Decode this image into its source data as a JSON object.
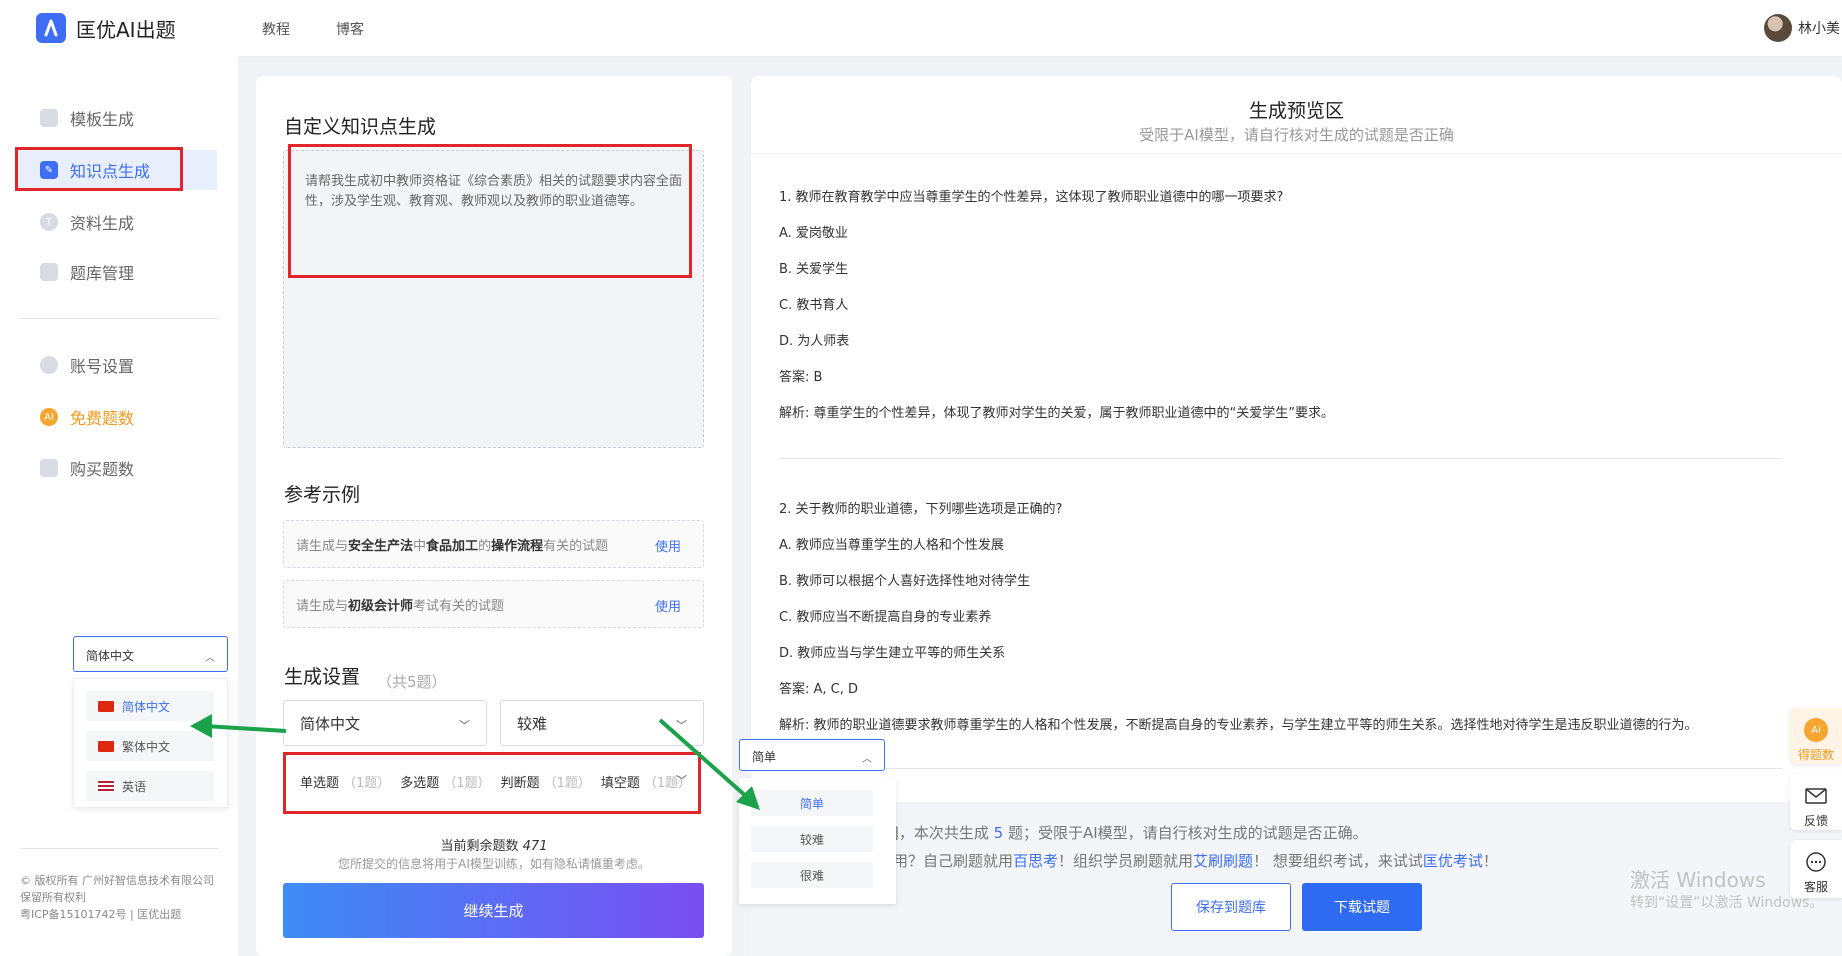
{
  "header": {
    "app_name": "匡优AI出题",
    "nav": [
      "教程",
      "博客"
    ],
    "user_name": "林小美"
  },
  "sidebar": {
    "items": [
      {
        "label": "模板生成",
        "icon": "template-icon"
      },
      {
        "label": "知识点生成",
        "icon": "knowledge-icon"
      },
      {
        "label": "资料生成",
        "icon": "material-icon"
      },
      {
        "label": "题库管理",
        "icon": "question-bank-icon"
      },
      {
        "label": "账号设置",
        "icon": "user-icon"
      },
      {
        "label": "免费题数",
        "icon": "free-quota-icon",
        "badge": "AI"
      },
      {
        "label": "购买题数",
        "icon": "purchase-icon"
      }
    ],
    "footer": [
      "© 版权所有 广州好智信息技术有限公司",
      "保留所有权利",
      "粤ICP备15101742号 | 匡优出题"
    ]
  },
  "language_dropdown": {
    "selected": "简体中文",
    "options": [
      "简体中文",
      "繁体中文",
      "英语"
    ]
  },
  "knowledge": {
    "title": "自定义知识点生成",
    "prompt": "请帮我生成初中教师资格证《综合素质》相关的试题要求内容全面性，涉及学生观、教育观、教师观以及教师的职业道德等。"
  },
  "examples": {
    "title": "参考示例",
    "items": [
      {
        "parts": [
          "请生成与",
          "安全生产法",
          "中",
          "食品加工",
          "的",
          "操作流程",
          "有关的试题"
        ],
        "action": "使用"
      },
      {
        "parts": [
          "请生成与",
          "初级会计师",
          "考试有关的试题"
        ],
        "action": "使用"
      }
    ]
  },
  "settings": {
    "title": "生成设置",
    "count_note": "（共5题）",
    "language": "简体中文",
    "difficulty": "较难",
    "question_types": [
      {
        "label": "单选题",
        "count": "（1题）"
      },
      {
        "label": "多选题",
        "count": "（1题）"
      },
      {
        "label": "判断题",
        "count": "（1题）"
      },
      {
        "label": "填空题",
        "count": "（1题）"
      },
      {
        "label": "问",
        "count": ""
      }
    ],
    "remaining_label": "当前剩余题数",
    "remaining_value": "471",
    "privacy_note": "您所提交的信息将用于AI模型训练，如有隐私请慎重考虑。",
    "generate_button": "继续生成"
  },
  "preview": {
    "title": "生成预览区",
    "subtitle": "受限于AI模型，请自行核对生成的试题是否正确",
    "q1": {
      "question": "1. 教师在教育教学中应当尊重学生的个性差异，这体现了教师职业道德中的哪一项要求?",
      "options": [
        "A. 爱岗敬业",
        "B. 关爱学生",
        "C. 教书育人",
        "D. 为人师表"
      ],
      "answer": "答案: B",
      "analysis": "解析: 尊重学生的个性差异，体现了教师对学生的关爱，属于教师职业道德中的“关爱学生”要求。"
    },
    "q2": {
      "question": "2. 关于教师的职业道德，下列哪些选项是正确的?",
      "options": [
        "A. 教师应当尊重学生的人格和个性发展",
        "B. 教师可以根据个人喜好选择性地对待学生",
        "C. 教师应当不断提高自身的专业素养",
        "D. 教师应当与学生建立平等的师生关系"
      ],
      "answer": "答案: A, C, D",
      "analysis": "解析: 教师的职业道德要求教师尊重学生的人格和个性发展，不断提高自身的专业素养，与学生建立平等的师生关系。选择性地对待学生是违反职业道德的行为。"
    },
    "notice_1_pre": "]，本次共生成",
    "notice_1_num": "5",
    "notice_1_post": "题；受限于AI模型，请自行核对生成的试题是否正确。",
    "notice_2_a": "用？自己刷题就用",
    "notice_2_link1": "百思考",
    "notice_2_b": "！组织学员刷题就用",
    "notice_2_link2": "艾刷刷题",
    "notice_2_c": "！ 想要组织考试，来试试",
    "notice_2_link3": "匡优考试",
    "notice_2_d": "！",
    "save_button": "保存到题库",
    "download_button": "下载试题"
  },
  "difficulty_dropdown": {
    "selected": "简单",
    "options": [
      "简单",
      "较难",
      "很难"
    ]
  },
  "float_tools": [
    {
      "label": "得题数",
      "icon": "ai-quota-icon",
      "badge": "Ai"
    },
    {
      "label": "反馈",
      "icon": "mail-icon"
    },
    {
      "label": "客服",
      "icon": "chat-icon"
    }
  ],
  "watermark": {
    "line1": "激活 Windows",
    "line2": "转到“设置”以激活 Windows。"
  }
}
